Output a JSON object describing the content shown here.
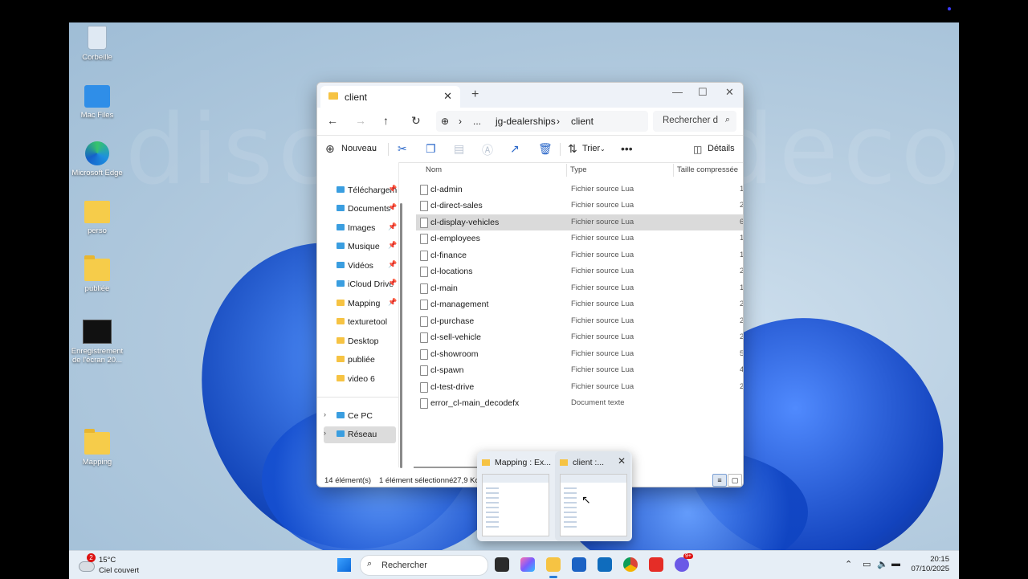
{
  "desktop": {
    "watermark": "discord.gg/decodefx",
    "icons": [
      {
        "label": "Corbeille",
        "icon": "recycle-bin-icon"
      },
      {
        "label": "Mac Files",
        "icon": "mac-folder-icon"
      },
      {
        "label": "Microsoft Edge",
        "icon": "edge-icon"
      },
      {
        "label": "perso",
        "icon": "folder-icon"
      },
      {
        "label": "publiée",
        "icon": "folder-icon"
      },
      {
        "label": "Enregistrement de l'écran 20...",
        "icon": "video-file-icon"
      },
      {
        "label": "Mapping",
        "icon": "folder-icon"
      }
    ]
  },
  "explorer": {
    "tab_title": "client",
    "breadcrumb": [
      "...",
      "jg-dealerships",
      "client"
    ],
    "search_placeholder": "Rechercher d",
    "toolbar": {
      "new_label": "Nouveau",
      "sort_label": "Trier",
      "details_label": "Détails"
    },
    "nav_items": [
      {
        "label": "Téléchargem",
        "pinned": true,
        "icon": "download-folder-icon"
      },
      {
        "label": "Documents",
        "pinned": true,
        "icon": "documents-folder-icon"
      },
      {
        "label": "Images",
        "pinned": true,
        "icon": "images-folder-icon"
      },
      {
        "label": "Musique",
        "pinned": true,
        "icon": "music-folder-icon"
      },
      {
        "label": "Vidéos",
        "pinned": true,
        "icon": "videos-folder-icon"
      },
      {
        "label": "iCloud Drive",
        "pinned": true,
        "icon": "icloud-folder-icon"
      },
      {
        "label": "Mapping",
        "pinned": true,
        "icon": "folder-icon"
      },
      {
        "label": "texturetool",
        "pinned": false,
        "icon": "folder-icon"
      },
      {
        "label": "Desktop",
        "pinned": false,
        "icon": "folder-icon"
      },
      {
        "label": "publiée",
        "pinned": false,
        "icon": "folder-icon"
      },
      {
        "label": "video 6",
        "pinned": false,
        "icon": "folder-icon"
      }
    ],
    "nav_roots": [
      {
        "label": "Ce PC",
        "icon": "pc-icon"
      },
      {
        "label": "Réseau",
        "icon": "network-icon"
      }
    ],
    "columns": {
      "name": "Nom",
      "type": "Type",
      "size": "Taille compressée"
    },
    "files": [
      {
        "name": "cl-admin",
        "type": "Fichier source Lua",
        "size": "1"
      },
      {
        "name": "cl-direct-sales",
        "type": "Fichier source Lua",
        "size": "2"
      },
      {
        "name": "cl-display-vehicles",
        "type": "Fichier source Lua",
        "size": "6"
      },
      {
        "name": "cl-employees",
        "type": "Fichier source Lua",
        "size": "1"
      },
      {
        "name": "cl-finance",
        "type": "Fichier source Lua",
        "size": "1"
      },
      {
        "name": "cl-locations",
        "type": "Fichier source Lua",
        "size": "2"
      },
      {
        "name": "cl-main",
        "type": "Fichier source Lua",
        "size": "1"
      },
      {
        "name": "cl-management",
        "type": "Fichier source Lua",
        "size": "2"
      },
      {
        "name": "cl-purchase",
        "type": "Fichier source Lua",
        "size": "2"
      },
      {
        "name": "cl-sell-vehicle",
        "type": "Fichier source Lua",
        "size": "2"
      },
      {
        "name": "cl-showroom",
        "type": "Fichier source Lua",
        "size": "5"
      },
      {
        "name": "cl-spawn",
        "type": "Fichier source Lua",
        "size": "4"
      },
      {
        "name": "cl-test-drive",
        "type": "Fichier source Lua",
        "size": "2"
      },
      {
        "name": "error_cl-main_decodefx",
        "type": "Document texte",
        "size": ""
      }
    ],
    "selected_file": "cl-display-vehicles",
    "status": {
      "count": "14 élément(s)",
      "selection": "1 élément sélectionné",
      "size": "27,9 Ko"
    }
  },
  "taskbar_preview": {
    "windows": [
      {
        "title": "Mapping : Ex..."
      },
      {
        "title": "client :..."
      }
    ]
  },
  "taskbar": {
    "weather": {
      "badge": "2",
      "temp": "15°C",
      "desc": "Ciel couvert"
    },
    "search_placeholder": "Rechercher",
    "apps": [
      "task-view-icon",
      "copilot-icon",
      "file-explorer-icon",
      "store-icon",
      "outlook-icon",
      "chrome-icon",
      "youtube-icon",
      "discord-icon"
    ],
    "discord_badge": "9+",
    "clock": {
      "time": "20:15",
      "date": "07/10/2025"
    }
  }
}
